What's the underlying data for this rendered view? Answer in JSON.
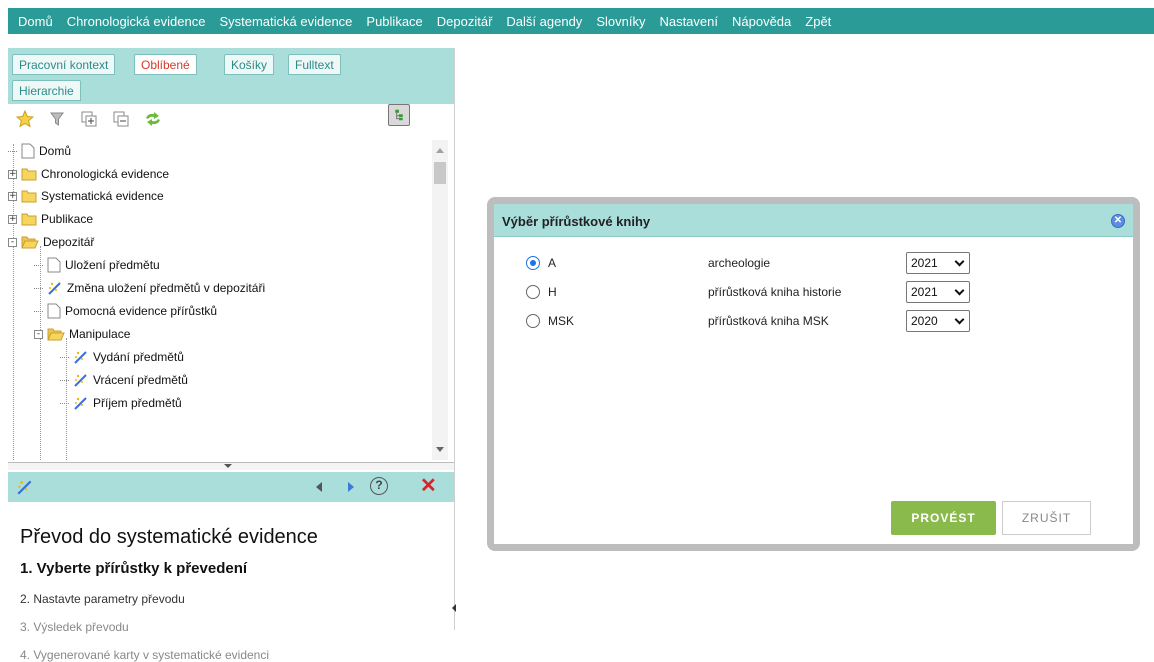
{
  "menu": [
    "Domů",
    "Chronologická evidence",
    "Systematická evidence",
    "Publikace",
    "Depozitář",
    "Další agendy",
    "Slovníky",
    "Nastavení",
    "Nápověda",
    "Zpět"
  ],
  "tabs": [
    "Pracovní kontext",
    "Oblíbené",
    "Košíky",
    "Fulltext",
    "Hierarchie"
  ],
  "active_tab": "Oblíbené",
  "toolbar_icons": [
    "star-icon",
    "filter-icon",
    "tree-icon",
    "expand-all-icon",
    "collapse-all-icon",
    "refresh-icon"
  ],
  "tree": [
    {
      "label": "Domů",
      "icon": "page"
    },
    {
      "label": "Chronologická evidence",
      "icon": "folder",
      "expander": "+"
    },
    {
      "label": "Systematická evidence",
      "icon": "folder",
      "expander": "+"
    },
    {
      "label": "Publikace",
      "icon": "folder",
      "expander": "+"
    },
    {
      "label": "Depozitář",
      "icon": "folder-open",
      "expander": "-"
    },
    {
      "label": "Uložení předmětu",
      "icon": "page"
    },
    {
      "label": "Změna uložení předmětů v depozitáři",
      "icon": "wand"
    },
    {
      "label": "Pomocná evidence přírůstků",
      "icon": "page"
    },
    {
      "label": "Manipulace",
      "icon": "folder-open",
      "expander": "-"
    },
    {
      "label": "Vydání předmětů",
      "icon": "wand"
    },
    {
      "label": "Vrácení předmětů",
      "icon": "wand"
    },
    {
      "label": "Příjem předmětů",
      "icon": "wand"
    }
  ],
  "wizard": {
    "title": "Převod do systematické evidence",
    "step1": "1. Vyberte přírůstky k převedení",
    "step2": "2. Nastavte parametry převodu",
    "step3": "3. Výsledek převodu",
    "step4": "4. Vygenerované karty v systematické evidenci"
  },
  "detail_bar": {
    "help": "?",
    "close": "✕"
  },
  "modal": {
    "title": "Výběr přírůstkové knihy",
    "close": "✕",
    "rows": [
      {
        "code": "A",
        "desc": "archeologie",
        "year": "2021",
        "selected": true
      },
      {
        "code": "H",
        "desc": "přírůstková kniha historie",
        "year": "2021",
        "selected": false
      },
      {
        "code": "MSK",
        "desc": "přírůstková kniha MSK",
        "year": "2020",
        "selected": false
      }
    ],
    "ok": "PROVÉST",
    "cancel": "ZRUŠIT"
  },
  "colors": {
    "menubar": "#2a9b97",
    "panel_header": "#a9dedb",
    "ok_button": "#8bba4c",
    "active_tab_text": "#d23a2a"
  }
}
